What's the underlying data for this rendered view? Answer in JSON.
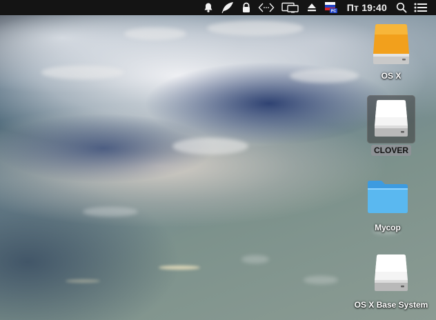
{
  "menubar": {
    "clock": "Пт 19:40",
    "input_badge": "PC",
    "icons": [
      "notification-bell-icon",
      "feather-icon",
      "lock-icon",
      "code-bracket-icon",
      "display-mirror-icon",
      "eject-icon",
      "input-source-flag-icon",
      "search-icon",
      "list-icon"
    ]
  },
  "desktop": {
    "items": [
      {
        "label": "OS X",
        "icon": "orange-drive-icon"
      },
      {
        "label": "CLOVER",
        "icon": "white-drive-icon",
        "selected": true
      },
      {
        "label": "Мусор",
        "icon": "folder-icon"
      },
      {
        "label": "OS X Base System",
        "icon": "white-drive-icon"
      }
    ]
  },
  "colors": {
    "menubar_bg": "#141414",
    "drive_orange": "#f2a01c",
    "folder_blue": "#5ab8f0",
    "selection_label": "#8e9296"
  }
}
